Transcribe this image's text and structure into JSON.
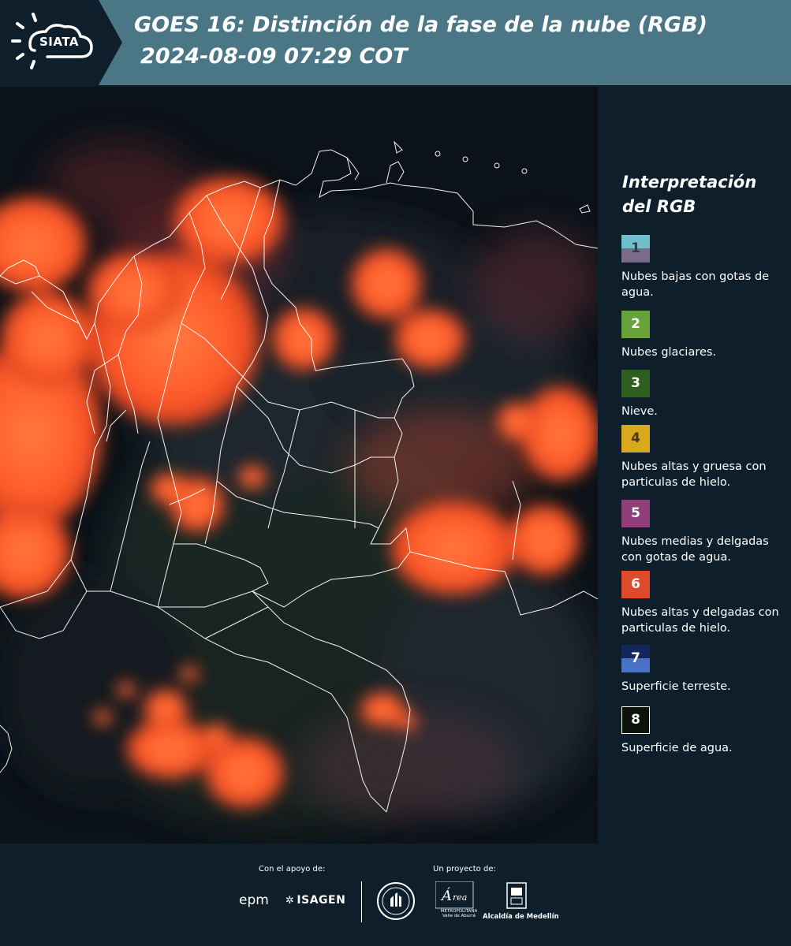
{
  "header": {
    "logo_text": "SIATA",
    "title_line1": "GOES 16: Distinción de la fase de la nube (RGB)",
    "title_line2": "2024-08-09 07:29 COT"
  },
  "map": {
    "background_color": "#0b1218",
    "cloud_color": "#ff5a2a",
    "border_color": "#ffffff"
  },
  "legend": {
    "title": "Interpretación del RGB",
    "items": [
      {
        "number": "1",
        "label": "Nubes bajas con gotas de agua.",
        "color_top": "#6fbfcc",
        "color_bottom": "#7a6b8a"
      },
      {
        "number": "2",
        "label": "Nubes glaciares.",
        "color": "#67a33a"
      },
      {
        "number": "3",
        "label": "Nieve.",
        "color": "#2e5f1e"
      },
      {
        "number": "4",
        "label": "Nubes altas y gruesa con particulas de hielo.",
        "color": "#d8a91a"
      },
      {
        "number": "5",
        "label": "Nubes medias y delgadas con gotas de agua.",
        "color": "#8f3f7a"
      },
      {
        "number": "6",
        "label": "Nubes altas y delgadas con particulas de hielo.",
        "color": "#e0492a"
      },
      {
        "number": "7",
        "label": "Superficie terreste.",
        "color_top": "#13265e",
        "color_bottom": "#4a72c4"
      },
      {
        "number": "8",
        "label": "Superficie de agua.",
        "color": "#0b130a"
      }
    ]
  },
  "footer": {
    "support_label": "Con el apoyo de:",
    "project_label": "Un proyecto de:",
    "epm": "epm",
    "isagen": "ISAGEN",
    "area_sub": "METROPOLITANA Valle de Aburrá",
    "alcaldia": "Alcaldía de Medellín"
  }
}
